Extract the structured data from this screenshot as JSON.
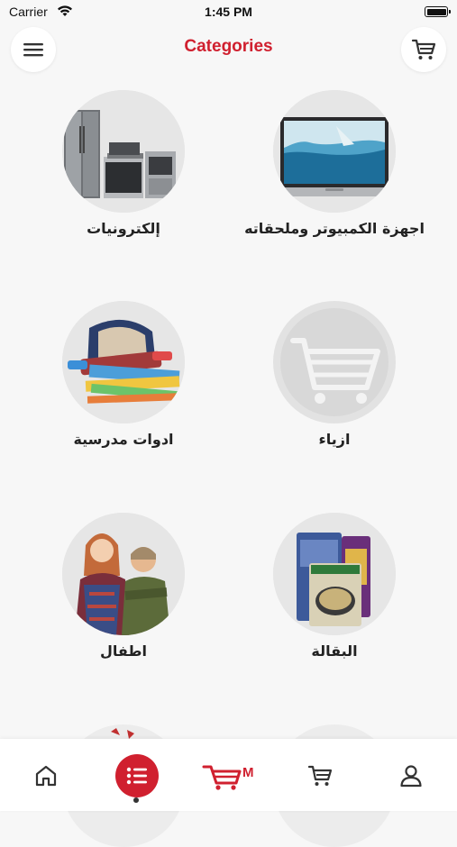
{
  "status_bar": {
    "carrier": "Carrier",
    "time": "1:45 PM"
  },
  "header": {
    "title": "Categories",
    "title_color": "#d0202f"
  },
  "categories": [
    {
      "label": "إلكترونيات",
      "icon": "appliances-image"
    },
    {
      "label": "اجهزة الكمبيوتر وملحقاته",
      "icon": "laptop-image"
    },
    {
      "label": "ادوات مدرسية",
      "icon": "school-supplies-image"
    },
    {
      "label": "ازياء",
      "icon": "cart-placeholder-icon"
    },
    {
      "label": "اطفال",
      "icon": "kids-image"
    },
    {
      "label": "البقالة",
      "icon": "grocery-image"
    }
  ],
  "tabbar": {
    "items": [
      "home-icon",
      "categories-icon",
      "market-cart-logo",
      "cart-icon",
      "profile-icon"
    ],
    "active": "categories",
    "logo_letter": "M",
    "accent": "#d0202f"
  }
}
